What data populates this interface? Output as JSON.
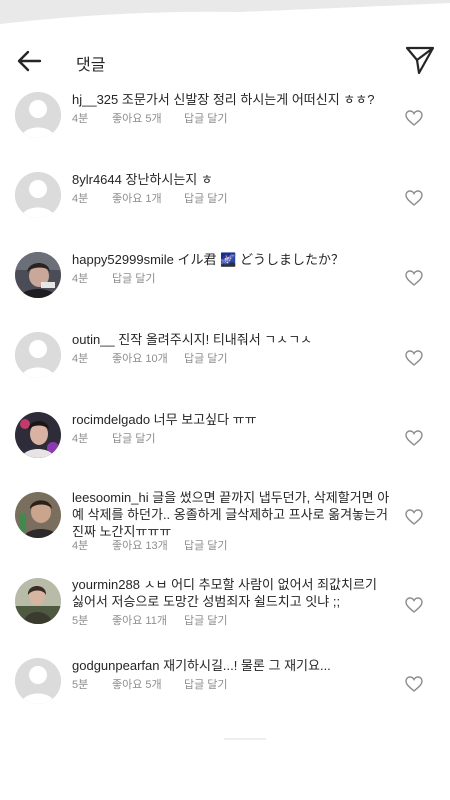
{
  "header": {
    "title": "댓글",
    "back_icon": "arrow-left-icon",
    "send_icon": "paper-plane-icon"
  },
  "colors": {
    "text": "#262626",
    "secondary": "#8e8e8e",
    "avatar_placeholder": "#dbdbdb"
  },
  "comments": [
    {
      "username": "hj__325",
      "text": "조문가서 신발장 정리 하시는게 어떠신지 ㅎㅎ?",
      "time": "4분",
      "likes": "좋아요 5개",
      "reply": "답글 달기",
      "avatar": "default-avatar"
    },
    {
      "username": "8ylr4644",
      "text": "장난하시는지 ㅎ",
      "time": "4분",
      "likes": "좋아요 1개",
      "reply": "답글 달기",
      "avatar": "default-avatar"
    },
    {
      "username": "happy52999smile",
      "text": "イル君 🌌 どうしましたか？",
      "time": "4분",
      "likes": "",
      "reply": "답글 달기",
      "avatar": "photo-avatar"
    },
    {
      "username": "outin__",
      "text": "진작 올려주시지! 티내줘서 ㄱㅅㄱㅅ",
      "time": "4분",
      "likes": "좋아요 10개",
      "reply": "답글 달기",
      "avatar": "default-avatar"
    },
    {
      "username": "rocimdelgado",
      "text": "너무 보고싶다 ㅠㅠ",
      "time": "4분",
      "likes": "",
      "reply": "답글 달기",
      "avatar": "photo-avatar"
    },
    {
      "username": "leesoomin_hi",
      "text": "글을 썼으면 끝까지 냅두던가, 삭제할거면 아예 삭제를 하던가.. 옹졸하게 글삭제하고 프사로 옮겨놓는거 진짜 노간지ㅠㅠㅠ",
      "time": "4분",
      "likes": "좋아요 13개",
      "reply": "답글 달기",
      "avatar": "photo-avatar"
    },
    {
      "username": "yourmin288",
      "text": "ㅅㅂ 어디 추모할 사람이 없어서 죄값치르기 싫어서 저승으로 도망간 성범죄자 쉴드치고 잇냐 ;;",
      "time": "5분",
      "likes": "좋아요 11개",
      "reply": "답글 달기",
      "avatar": "photo-avatar"
    },
    {
      "username": "godgunpearfan",
      "text": "재기하시길...! 물론 그 재기요...",
      "time": "5분",
      "likes": "좋아요 5개",
      "reply": "답글 달기",
      "avatar": "default-avatar"
    }
  ]
}
